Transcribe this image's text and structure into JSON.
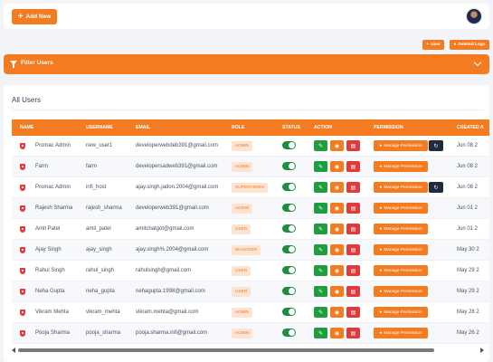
{
  "header": {
    "add_label": "Add New"
  },
  "actions": {
    "user_label": "User",
    "logs_label": "Deleted Logs"
  },
  "filter": {
    "label": "Filter Users"
  },
  "card": {
    "title": "All Users"
  },
  "table": {
    "columns": [
      "NAME",
      "USERNAME",
      "EMAIL",
      "ROLE",
      "STATUS",
      "ACTION",
      "PERMISSION",
      "CREATED A"
    ],
    "permission_label": "Manage Permission",
    "rows": [
      {
        "name": "Promac Admin",
        "username": "new_user1",
        "email": "developerwebdeb391@gmail.com",
        "role": "ADMIN",
        "created": "Jun 08 2",
        "reset": true
      },
      {
        "name": "Farm",
        "username": "farm",
        "email": "developersadweb391@gmail.com",
        "role": "ADMIN",
        "created": "Jun 08 2",
        "reset": false
      },
      {
        "name": "Promac Admin",
        "username": "infi_host",
        "email": "ajay.singh.jadon.2004@gmail.com",
        "role": "SUPERADMIN",
        "created": "Jun 08 2",
        "reset": true
      },
      {
        "name": "Rajesh Sharma",
        "username": "rajesh_sharma",
        "email": "developerweb391@gmail.com",
        "role": "ADMIN",
        "created": "Jun 01 2",
        "reset": false
      },
      {
        "name": "Amit Patel",
        "username": "amit_patel",
        "email": "amitchatgot@gmail.com",
        "role": "USER",
        "created": "Jun 01 2",
        "reset": false
      },
      {
        "name": "Ajay Singh",
        "username": "ajay_singh",
        "email": "ajay.singh%.2004@gmail.com",
        "role": "MANAGER",
        "created": "May 30 2",
        "reset": false
      },
      {
        "name": "Rahul Singh",
        "username": "rahul_singh",
        "email": "rahulsingh@gmail.com",
        "role": "USER",
        "created": "May 29 2",
        "reset": false
      },
      {
        "name": "Neha Gupta",
        "username": "neha_gupta",
        "email": "nehagupta.1998@gmail.com",
        "role": "USER",
        "created": "May 29 2",
        "reset": false
      },
      {
        "name": "Vikram Mehta",
        "username": "vikram_mehta",
        "email": "vikram.mehta@gmail.com",
        "role": "ADMIN",
        "created": "May 28 2",
        "reset": false
      },
      {
        "name": "Pooja Sharma",
        "username": "pooja_sharma",
        "email": "pooja.sharma.infi@gmail.com",
        "role": "ADMIN",
        "created": "May 26 2",
        "reset": false
      }
    ]
  }
}
